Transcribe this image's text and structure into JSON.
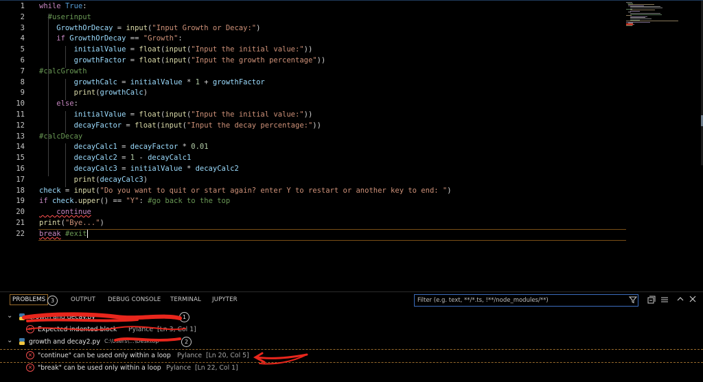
{
  "editor": {
    "line_numbers": [
      "1",
      "2",
      "3",
      "4",
      "5",
      "6",
      "7",
      "8",
      "9",
      "10",
      "11",
      "12",
      "13",
      "14",
      "15",
      "16",
      "17",
      "18",
      "19",
      "20",
      "21",
      "22"
    ],
    "lines": [
      [
        {
          "t": "while",
          "c": "kw"
        },
        {
          "t": " ",
          "c": "op"
        },
        {
          "t": "True",
          "c": "kw2"
        },
        {
          "t": ":",
          "c": "op"
        }
      ],
      [
        {
          "t": "  #userinput",
          "c": "cm"
        }
      ],
      [
        {
          "t": "    GrowthOrDecay",
          "c": "var"
        },
        {
          "t": " = ",
          "c": "op"
        },
        {
          "t": "input",
          "c": "fn"
        },
        {
          "t": "(",
          "c": "op"
        },
        {
          "t": "\"Input Growth or Decay:\"",
          "c": "str"
        },
        {
          "t": ")",
          "c": "op"
        }
      ],
      [
        {
          "t": "    if",
          "c": "kw"
        },
        {
          "t": " ",
          "c": "op"
        },
        {
          "t": "GrowthOrDecay",
          "c": "var"
        },
        {
          "t": " == ",
          "c": "op"
        },
        {
          "t": "\"Growth\"",
          "c": "str"
        },
        {
          "t": ":",
          "c": "op"
        }
      ],
      [
        {
          "t": "        initialValue",
          "c": "var"
        },
        {
          "t": " = ",
          "c": "op"
        },
        {
          "t": "float",
          "c": "fn"
        },
        {
          "t": "(",
          "c": "op"
        },
        {
          "t": "input",
          "c": "fn"
        },
        {
          "t": "(",
          "c": "op"
        },
        {
          "t": "\"Input the initial value:\"",
          "c": "str"
        },
        {
          "t": "))",
          "c": "op"
        }
      ],
      [
        {
          "t": "        growthFactor",
          "c": "var"
        },
        {
          "t": " = ",
          "c": "op"
        },
        {
          "t": "float",
          "c": "fn"
        },
        {
          "t": "(",
          "c": "op"
        },
        {
          "t": "input",
          "c": "fn"
        },
        {
          "t": "(",
          "c": "op"
        },
        {
          "t": "\"Input the growth percentage\"",
          "c": "str"
        },
        {
          "t": "))",
          "c": "op"
        }
      ],
      [
        {
          "t": "#calcGrowth",
          "c": "cm"
        }
      ],
      [
        {
          "t": "        growthCalc",
          "c": "var"
        },
        {
          "t": " = ",
          "c": "op"
        },
        {
          "t": "initialValue",
          "c": "var"
        },
        {
          "t": " * ",
          "c": "op"
        },
        {
          "t": "1",
          "c": "num"
        },
        {
          "t": " + ",
          "c": "op"
        },
        {
          "t": "growthFactor",
          "c": "var"
        }
      ],
      [
        {
          "t": "        print",
          "c": "fn"
        },
        {
          "t": "(",
          "c": "op"
        },
        {
          "t": "growthCalc",
          "c": "var"
        },
        {
          "t": ")",
          "c": "op"
        }
      ],
      [
        {
          "t": "    else",
          "c": "kw"
        },
        {
          "t": ":",
          "c": "op"
        }
      ],
      [
        {
          "t": "        initialValue",
          "c": "var"
        },
        {
          "t": " = ",
          "c": "op"
        },
        {
          "t": "float",
          "c": "fn"
        },
        {
          "t": "(",
          "c": "op"
        },
        {
          "t": "input",
          "c": "fn"
        },
        {
          "t": "(",
          "c": "op"
        },
        {
          "t": "\"Input the initial value:\"",
          "c": "str"
        },
        {
          "t": "))",
          "c": "op"
        }
      ],
      [
        {
          "t": "        decayFactor",
          "c": "var"
        },
        {
          "t": " = ",
          "c": "op"
        },
        {
          "t": "float",
          "c": "fn"
        },
        {
          "t": "(",
          "c": "op"
        },
        {
          "t": "input",
          "c": "fn"
        },
        {
          "t": "(",
          "c": "op"
        },
        {
          "t": "\"Input the decay percentage:\"",
          "c": "str"
        },
        {
          "t": "))",
          "c": "op"
        }
      ],
      [
        {
          "t": "#calcDecay",
          "c": "cm"
        }
      ],
      [
        {
          "t": "        decayCalc1",
          "c": "var"
        },
        {
          "t": " = ",
          "c": "op"
        },
        {
          "t": "decayFactor",
          "c": "var"
        },
        {
          "t": " * ",
          "c": "op"
        },
        {
          "t": "0.01",
          "c": "num"
        }
      ],
      [
        {
          "t": "        decayCalc2",
          "c": "var"
        },
        {
          "t": " = ",
          "c": "op"
        },
        {
          "t": "1",
          "c": "num"
        },
        {
          "t": " - ",
          "c": "op"
        },
        {
          "t": "decayCalc1",
          "c": "var"
        }
      ],
      [
        {
          "t": "        decayCalc3",
          "c": "var"
        },
        {
          "t": " = ",
          "c": "op"
        },
        {
          "t": "initialValue",
          "c": "var"
        },
        {
          "t": " * ",
          "c": "op"
        },
        {
          "t": "decayCalc2",
          "c": "var"
        }
      ],
      [
        {
          "t": "        print",
          "c": "fn"
        },
        {
          "t": "(",
          "c": "op"
        },
        {
          "t": "decayCalc3",
          "c": "var"
        },
        {
          "t": ")",
          "c": "op"
        }
      ],
      [
        {
          "t": "check",
          "c": "var"
        },
        {
          "t": " = ",
          "c": "op"
        },
        {
          "t": "input",
          "c": "fn"
        },
        {
          "t": "(",
          "c": "op"
        },
        {
          "t": "\"Do you want to quit or start again? enter Y to restart or another key to end: \"",
          "c": "str"
        },
        {
          "t": ")",
          "c": "op"
        }
      ],
      [
        {
          "t": "if",
          "c": "kw"
        },
        {
          "t": " ",
          "c": "op"
        },
        {
          "t": "check",
          "c": "var"
        },
        {
          "t": ".",
          "c": "op"
        },
        {
          "t": "upper",
          "c": "fn"
        },
        {
          "t": "() == ",
          "c": "op"
        },
        {
          "t": "\"Y\"",
          "c": "str"
        },
        {
          "t": ": ",
          "c": "op"
        },
        {
          "t": "#go back to the top",
          "c": "cm"
        }
      ],
      [
        {
          "t": "    continue",
          "c": "kw",
          "err": true
        }
      ],
      [
        {
          "t": "print",
          "c": "fn"
        },
        {
          "t": "(",
          "c": "op"
        },
        {
          "t": "\"Bye...\"",
          "c": "str"
        },
        {
          "t": ")",
          "c": "op"
        }
      ],
      [
        {
          "t": "break",
          "c": "kw",
          "err": true
        },
        {
          "t": " ",
          "c": "op"
        },
        {
          "t": "#exit",
          "c": "cm"
        }
      ]
    ]
  },
  "panel": {
    "tabs": {
      "problems": "PROBLEMS",
      "problems_count": "3",
      "output": "OUTPUT",
      "debug_console": "DEBUG CONSOLE",
      "terminal": "TERMINAL",
      "jupyter": "JUPYTER"
    },
    "filter_placeholder": "Filter (e.g. text, **/*.ts, !**/node_modules/**)",
    "icons": [
      "filter-icon",
      "collapse-all-icon",
      "view-as-list-icon",
      "chevron-up-icon",
      "close-icon"
    ],
    "groups": [
      {
        "file": "growth and decay.py",
        "path": "",
        "count": "1",
        "items": [
          {
            "message": "Expected indented block",
            "source": "Pylance",
            "location": "[Ln 3, Col 1]"
          }
        ]
      },
      {
        "file": "growth and decay2.py",
        "path": "C:\\Users\\...\\Desktop",
        "count": "2",
        "items": [
          {
            "message": "\"continue\" can be used only within a loop",
            "source": "Pylance",
            "location": "[Ln 20, Col 5]"
          },
          {
            "message": "\"break\" can be used only within a loop",
            "source": "Pylance",
            "location": "[Ln 22, Col 1]"
          }
        ]
      }
    ]
  },
  "colors": {
    "background": "#000000",
    "accent_border": "#9a6c2c",
    "error": "#f14c4c",
    "annotation": "#e8261c"
  }
}
